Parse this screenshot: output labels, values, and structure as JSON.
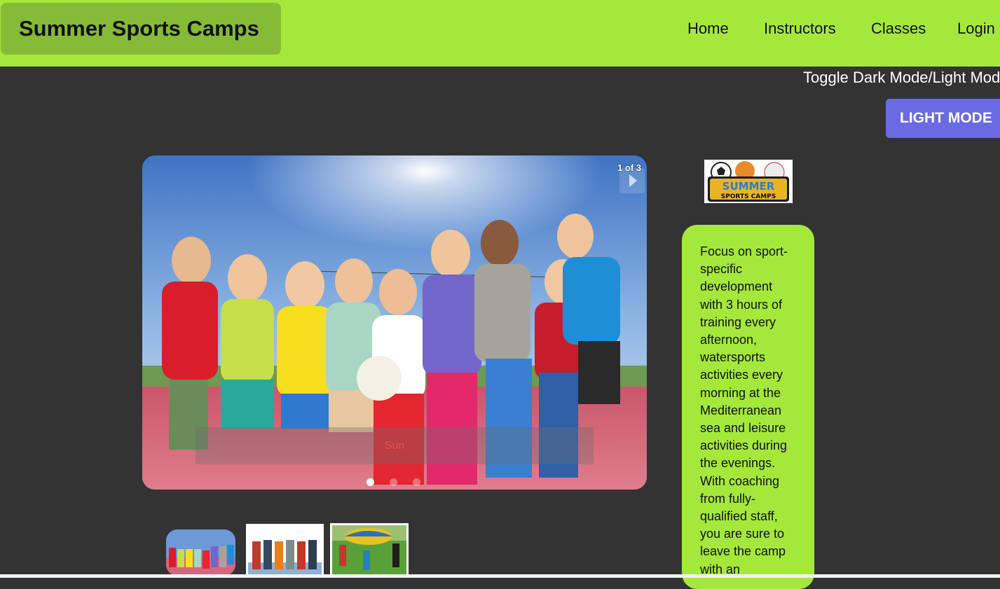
{
  "header": {
    "brand": "Summer Sports Camps",
    "nav": [
      "Home",
      "Instructors",
      "Classes",
      "Login"
    ]
  },
  "toggle": {
    "label": "Toggle Dark Mode/Light Mod",
    "button": "LIGHT MODE"
  },
  "slider": {
    "counter": "1 of 3",
    "caption": "Sun",
    "active_slide": 1,
    "slide_count": 3
  },
  "logo": {
    "line1": "SUMMER",
    "line2": "SPORTS CAMPS"
  },
  "info": {
    "text": "Focus on sport-specific development with 3 hours of training every afternoon, watersports activities every morning at the Mediterranean sea and leisure activities during the evenings. With coaching from fully-qualified staff, you are sure to leave the camp with an"
  },
  "colors": {
    "header_bg": "#a5e83c",
    "brand_bg": "#86bb37",
    "page_bg": "#333333",
    "button_bg": "#6a6ae2"
  }
}
